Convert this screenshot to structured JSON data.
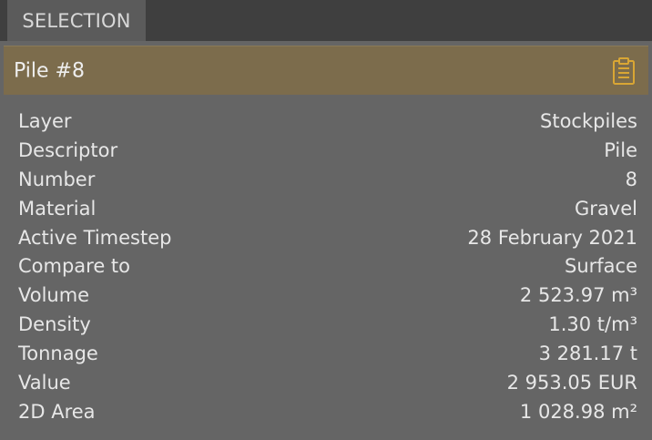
{
  "tab": {
    "label": "SELECTION"
  },
  "header": {
    "title": "Pile #8",
    "icon": "clipboard-icon",
    "accent": "#d9a634"
  },
  "properties": [
    {
      "label": "Layer",
      "value": "Stockpiles"
    },
    {
      "label": "Descriptor",
      "value": "Pile"
    },
    {
      "label": "Number",
      "value": "8"
    },
    {
      "label": "Material",
      "value": "Gravel"
    },
    {
      "label": "Active Timestep",
      "value": "28 February 2021"
    },
    {
      "label": "Compare to",
      "value": "Surface"
    },
    {
      "label": "Volume",
      "value": "2 523.97 m³"
    },
    {
      "label": "Density",
      "value": "1.30 t/m³"
    },
    {
      "label": "Tonnage",
      "value": "3 281.17 t"
    },
    {
      "label": "Value",
      "value": "2 953.05 EUR"
    },
    {
      "label": "2D Area",
      "value": "1 028.98 m²"
    }
  ]
}
